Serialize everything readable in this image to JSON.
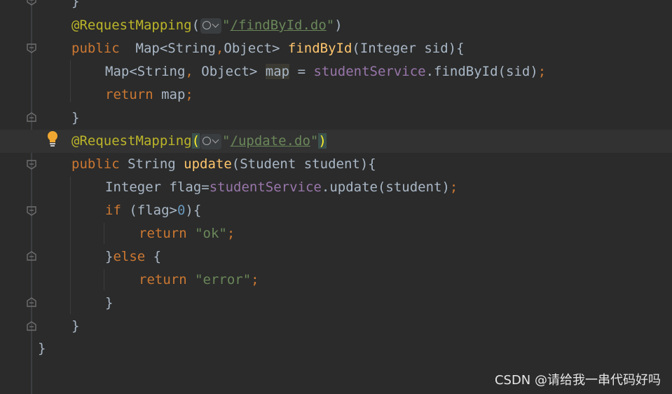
{
  "editor": {
    "lines": [
      {
        "id": "l0",
        "parts": [
          {
            "t": "}",
            "c": ""
          }
        ]
      },
      {
        "id": "l1",
        "parts": [
          {
            "t": "@RequestMapping",
            "c": "ann"
          },
          {
            "t": "(",
            "c": ""
          },
          {
            "t": "__INLAY__",
            "c": "inlay"
          },
          {
            "t": "\"",
            "c": "str"
          },
          {
            "t": "/findById.do",
            "c": "url"
          },
          {
            "t": "\"",
            "c": "str"
          },
          {
            "t": ")",
            "c": ""
          }
        ]
      },
      {
        "id": "l2",
        "parts": [
          {
            "t": "public",
            "c": "kw"
          },
          {
            "t": "  Map<String",
            "c": ""
          },
          {
            "t": ",",
            "c": "kw"
          },
          {
            "t": "Object> ",
            "c": ""
          },
          {
            "t": "findById",
            "c": "fn"
          },
          {
            "t": "(Integer sid){",
            "c": ""
          }
        ]
      },
      {
        "id": "l3",
        "parts": [
          {
            "t": "Map<String",
            "c": ""
          },
          {
            "t": ",",
            "c": "kw"
          },
          {
            "t": " Object> ",
            "c": ""
          },
          {
            "t": "map",
            "c": "hl-var"
          },
          {
            "t": " = ",
            "c": ""
          },
          {
            "t": "studentService",
            "c": "field"
          },
          {
            "t": ".findById(sid)",
            "c": ""
          },
          {
            "t": ";",
            "c": "kw"
          }
        ]
      },
      {
        "id": "l4",
        "parts": [
          {
            "t": "return",
            "c": "kw"
          },
          {
            "t": " map",
            "c": ""
          },
          {
            "t": ";",
            "c": "kw"
          }
        ]
      },
      {
        "id": "l5",
        "parts": [
          {
            "t": "}",
            "c": ""
          }
        ]
      },
      {
        "id": "l6",
        "parts": [
          {
            "t": "@RequestMapping",
            "c": "ann"
          },
          {
            "t": "(",
            "c": "paren-match"
          },
          {
            "t": "__INLAY__",
            "c": "inlay"
          },
          {
            "t": "\"",
            "c": "str"
          },
          {
            "t": "/update.do",
            "c": "url"
          },
          {
            "t": "\"",
            "c": "str"
          },
          {
            "t": ")",
            "c": "paren-match"
          }
        ]
      },
      {
        "id": "l7",
        "parts": [
          {
            "t": "public",
            "c": "kw"
          },
          {
            "t": " String ",
            "c": ""
          },
          {
            "t": "update",
            "c": "fn"
          },
          {
            "t": "(Student student){",
            "c": ""
          }
        ]
      },
      {
        "id": "l8",
        "parts": [
          {
            "t": "Integer flag=",
            "c": ""
          },
          {
            "t": "studentService",
            "c": "field"
          },
          {
            "t": ".update(student)",
            "c": ""
          },
          {
            "t": ";",
            "c": "kw"
          }
        ]
      },
      {
        "id": "l9",
        "parts": [
          {
            "t": "if",
            "c": "kw"
          },
          {
            "t": " (flag>",
            "c": ""
          },
          {
            "t": "0",
            "c": "num"
          },
          {
            "t": "){",
            "c": ""
          }
        ]
      },
      {
        "id": "l10",
        "parts": [
          {
            "t": "return",
            "c": "kw"
          },
          {
            "t": " ",
            "c": ""
          },
          {
            "t": "\"ok\"",
            "c": "str"
          },
          {
            "t": ";",
            "c": "kw"
          }
        ]
      },
      {
        "id": "l11",
        "parts": [
          {
            "t": "}",
            "c": ""
          },
          {
            "t": "else",
            "c": "kw"
          },
          {
            "t": " {",
            "c": ""
          }
        ]
      },
      {
        "id": "l12",
        "parts": [
          {
            "t": "return",
            "c": "kw"
          },
          {
            "t": " ",
            "c": ""
          },
          {
            "t": "\"error\"",
            "c": "str"
          },
          {
            "t": ";",
            "c": "kw"
          }
        ]
      },
      {
        "id": "l13",
        "parts": [
          {
            "t": "}",
            "c": ""
          }
        ]
      },
      {
        "id": "l14",
        "parts": [
          {
            "t": "}",
            "c": ""
          }
        ]
      },
      {
        "id": "l15",
        "parts": [
          {
            "t": "}",
            "c": ""
          }
        ]
      }
    ]
  },
  "colors": {
    "background": "#2b2b2b",
    "keyword": "#cc7832",
    "annotation": "#bbb529",
    "function": "#ffc66d",
    "string": "#6a8759",
    "field": "#9876aa",
    "number": "#6897bb",
    "text": "#a9b7c6"
  },
  "icons": {
    "bulb": "lightbulb-icon",
    "fold": "fold-marker-icon",
    "inlay": "globe-dropdown-icon"
  },
  "watermark": "CSDN @请给我一串代码好吗"
}
